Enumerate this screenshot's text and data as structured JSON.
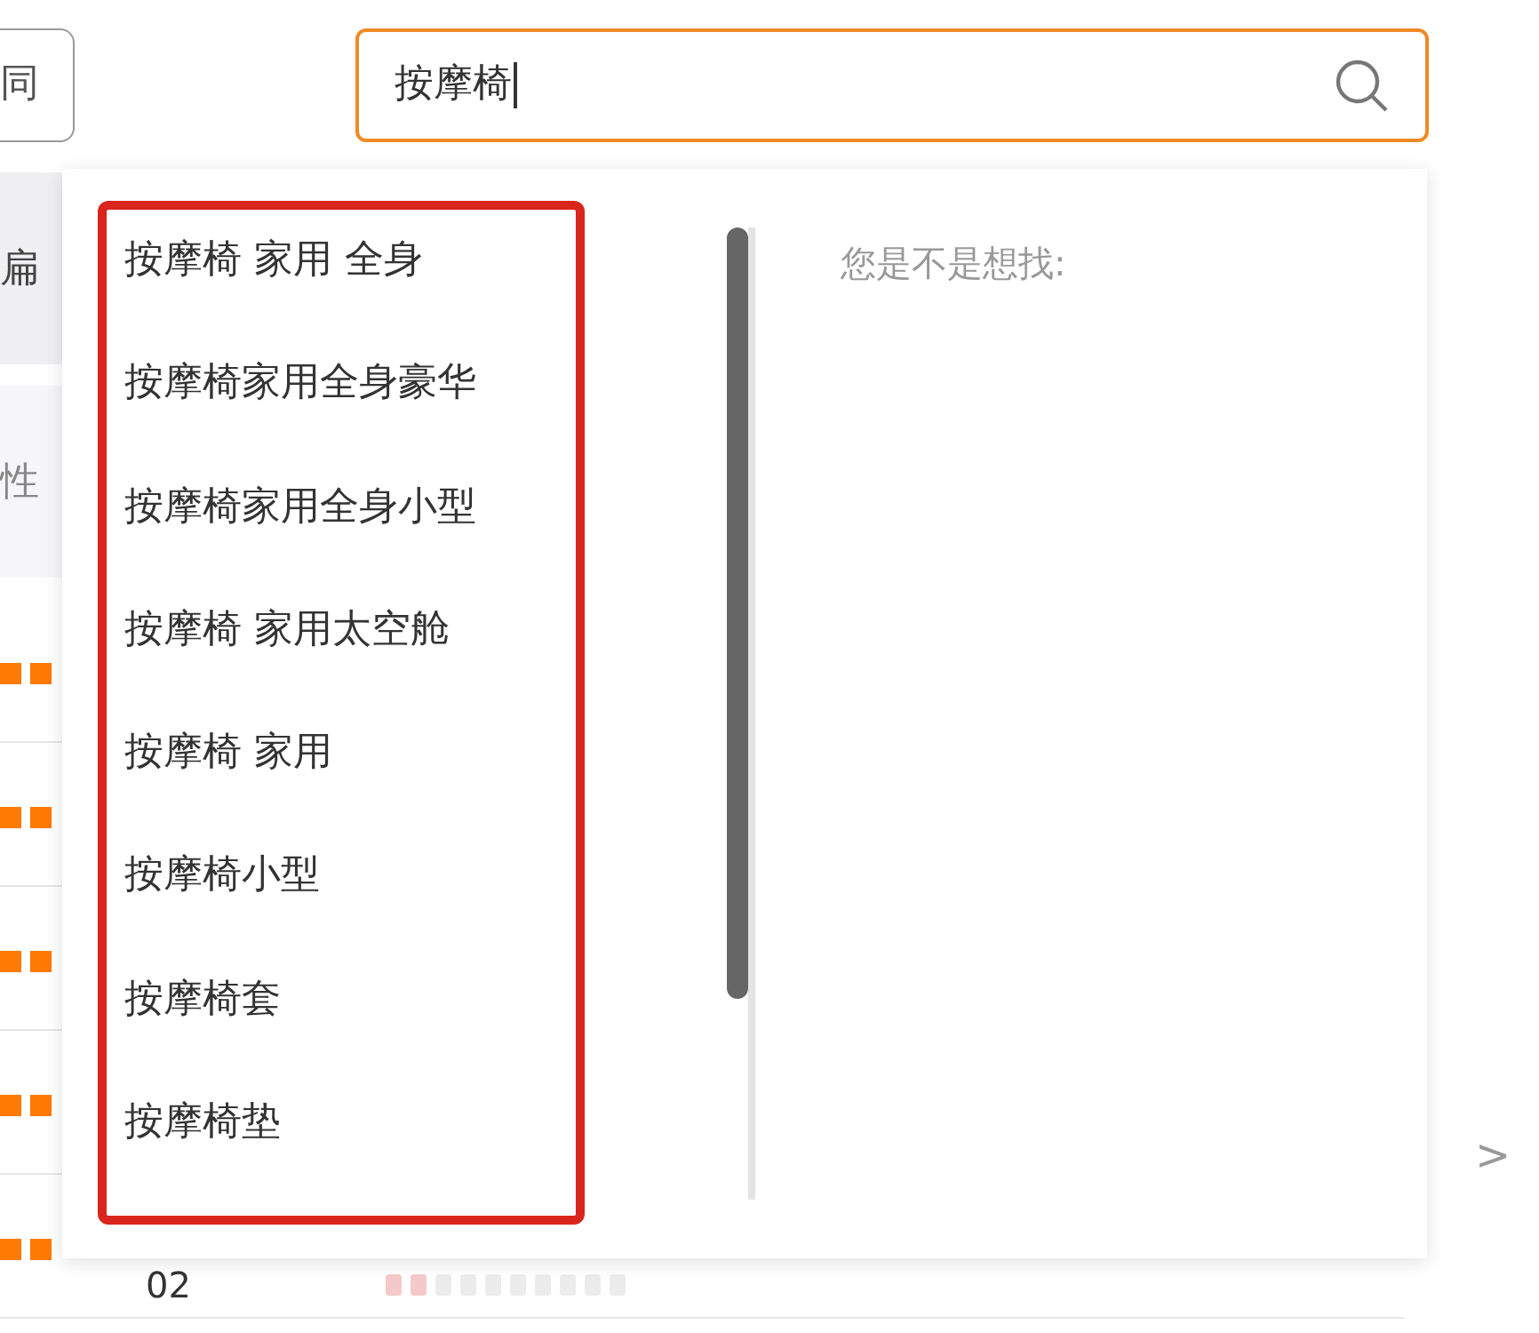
{
  "toolbar": {
    "button": "同",
    "search": {
      "value": "按摩椅"
    }
  },
  "filters": [
    {
      "label": "扁"
    },
    {
      "label": "性"
    }
  ],
  "rows": [
    {
      "kind": "marker"
    },
    {
      "kind": "marker"
    },
    {
      "kind": "marker"
    },
    {
      "kind": "marker"
    },
    {
      "kind": "numbered",
      "number": "02"
    }
  ],
  "pager": ">",
  "dropdown": {
    "suggestions": [
      "按摩椅 家用 全身",
      "按摩椅家用全身豪华",
      "按摩椅家用全身小型",
      "按摩椅 家用太空舱",
      "按摩椅 家用",
      "按摩椅小型",
      "按摩椅套",
      "按摩椅垫"
    ],
    "hint": "您是不是想找:"
  }
}
